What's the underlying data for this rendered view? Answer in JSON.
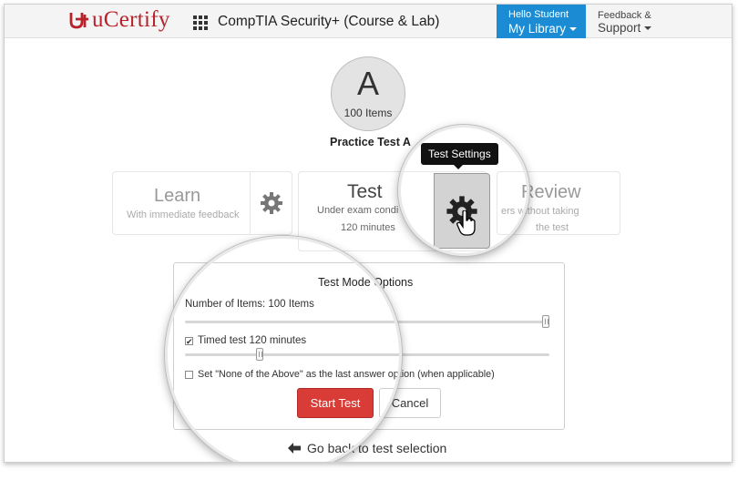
{
  "header": {
    "brand": "uCertify",
    "course_title": "CompTIA Security+ (Course & Lab)",
    "library_greeting": "Hello Student",
    "library_label": "My Library",
    "feedback_label": "Feedback &",
    "support_label": "Support"
  },
  "test": {
    "avatar_letter": "A",
    "items_label": "100 Items",
    "name": "Practice Test A"
  },
  "modes": {
    "learn_title": "Learn",
    "learn_sub": "With immediate feedback",
    "test_title": "Test",
    "test_sub": "Under exam condi",
    "test_sub2": "120 minutes",
    "review_title": "Review",
    "review_sub": "ers without taking",
    "review_sub2": "the test",
    "tooltip": "Test Settings"
  },
  "options": {
    "title": "Test Mode Options",
    "number_items": "Number of Items: 100 Items",
    "items_fraction": 1.0,
    "timed_label": "Timed test 120 minutes",
    "timed_checked": true,
    "time_fraction": 0.2,
    "none_label": "Set \"None of the Above\" as the last answer option (when applicable)",
    "none_checked": false,
    "start_button": "Start Test",
    "cancel_button": "Cancel"
  },
  "footer": {
    "back_label": "Go back to test selection"
  },
  "colors": {
    "brand_red": "#b8222b",
    "library_blue": "#1b8bd3",
    "start_red": "#d93c36"
  }
}
